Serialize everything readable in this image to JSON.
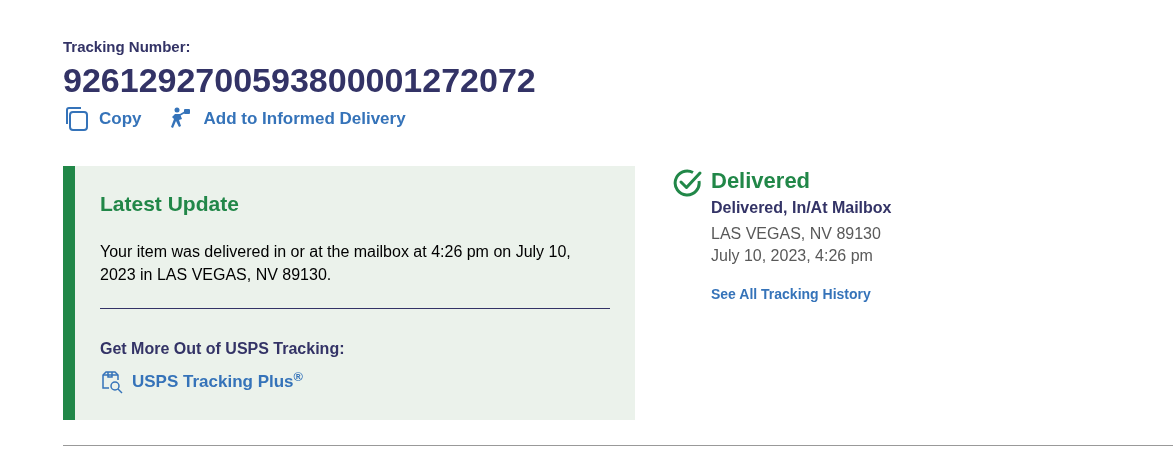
{
  "tracking": {
    "label": "Tracking Number:",
    "number": "9261292700593800001272072"
  },
  "actions": [
    {
      "kind": "copy",
      "label": "Copy"
    },
    {
      "kind": "informed",
      "label": "Add to Informed Delivery"
    }
  ],
  "latest_update": {
    "title": "Latest Update",
    "message": "Your item was delivered in or at the mailbox at 4:26 pm on July 10, 2023 in LAS VEGAS, NV 89130.",
    "more_heading": "Get More Out of USPS Tracking:",
    "more_link": "USPS Tracking Plus$^{®}$"
  },
  "status": {
    "title": "Delivered",
    "detail": "Delivered, In/At Mailbox",
    "location": "LAS VEGAS, NV 89130",
    "datetime": "July 10, 2023, 4:26 pm",
    "history_link": "See All Tracking History"
  }
}
